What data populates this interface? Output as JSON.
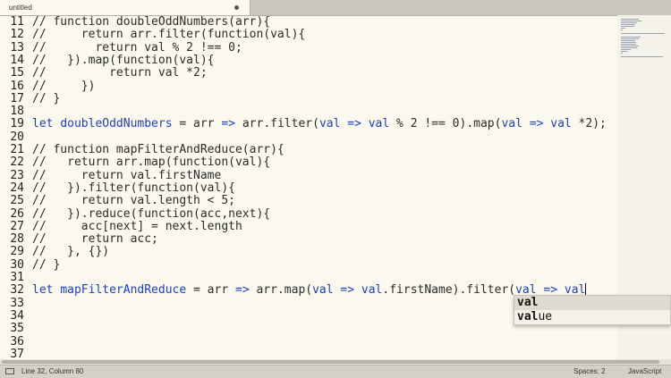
{
  "tab": {
    "title": "untitled"
  },
  "editor": {
    "lines": [
      {
        "num": "11",
        "code": "// function doubleOddNumbers(arr){"
      },
      {
        "num": "12",
        "code": "//     return arr.filter(function(val){"
      },
      {
        "num": "13",
        "code": "//       return val % 2 !== 0;"
      },
      {
        "num": "14",
        "code": "//   }).map(function(val){"
      },
      {
        "num": "15",
        "code": "//         return val *2;"
      },
      {
        "num": "16",
        "code": "//     })"
      },
      {
        "num": "17",
        "code": "// }"
      },
      {
        "num": "18",
        "code": ""
      },
      {
        "num": "19",
        "code": "let doubleOddNumbers = arr => arr.filter(val => val % 2 !== 0).map(val => val *2);"
      },
      {
        "num": "20",
        "code": ""
      },
      {
        "num": "21",
        "code": "// function mapFilterAndReduce(arr){"
      },
      {
        "num": "22",
        "code": "//   return arr.map(function(val){"
      },
      {
        "num": "23",
        "code": "//     return val.firstName"
      },
      {
        "num": "24",
        "code": "//   }).filter(function(val){"
      },
      {
        "num": "25",
        "code": "//     return val.length < 5;"
      },
      {
        "num": "26",
        "code": "//   }).reduce(function(acc,next){"
      },
      {
        "num": "27",
        "code": "//     acc[next] = next.length"
      },
      {
        "num": "28",
        "code": "//     return acc;"
      },
      {
        "num": "29",
        "code": "//   }, {})"
      },
      {
        "num": "30",
        "code": "// }"
      },
      {
        "num": "31",
        "code": ""
      },
      {
        "num": "32",
        "code": "let mapFilterAndReduce = arr => arr.map(val => val.firstName).filter(val => val"
      },
      {
        "num": "33",
        "code": ""
      },
      {
        "num": "34",
        "code": ""
      },
      {
        "num": "35",
        "code": ""
      },
      {
        "num": "36",
        "code": ""
      },
      {
        "num": "37",
        "code": ""
      }
    ]
  },
  "autocomplete": {
    "items": [
      {
        "match": "val",
        "rest": ""
      },
      {
        "match": "val",
        "rest": "ue"
      }
    ]
  },
  "status": {
    "position": "Line 32, Column 80",
    "spaces": "Spaces: 2",
    "syntax": "JavaScript"
  }
}
